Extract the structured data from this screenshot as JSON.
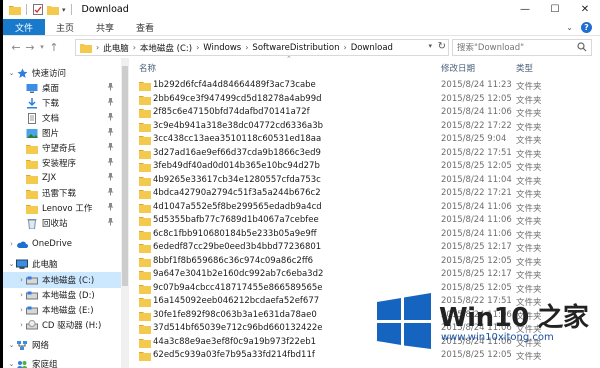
{
  "window": {
    "title": "Download",
    "quick_access_icons": [
      "folder-icon",
      "checkmark-doc-icon",
      "folder-icon"
    ],
    "buttons": [
      "minimize",
      "maximize",
      "close"
    ]
  },
  "ribbon": {
    "tabs": [
      "文件",
      "主页",
      "共享",
      "查看"
    ]
  },
  "address": {
    "crumbs": [
      "此电脑",
      "本地磁盘 (C:)",
      "Windows",
      "SoftwareDistribution",
      "Download"
    ],
    "search_placeholder": "搜索\"Download\""
  },
  "nav": {
    "items": [
      {
        "label": "快速访问",
        "icon": "star-icon",
        "level": 0,
        "pinned": false
      },
      {
        "label": "桌面",
        "icon": "desktop-icon",
        "level": 1,
        "pinned": true
      },
      {
        "label": "下载",
        "icon": "download-icon",
        "level": 1,
        "pinned": true
      },
      {
        "label": "文档",
        "icon": "document-icon",
        "level": 1,
        "pinned": true
      },
      {
        "label": "图片",
        "icon": "pictures-icon",
        "level": 1,
        "pinned": true
      },
      {
        "label": "守望奇兵",
        "icon": "folder-icon",
        "level": 1,
        "pinned": true
      },
      {
        "label": "安装程序",
        "icon": "folder-icon",
        "level": 1,
        "pinned": true
      },
      {
        "label": "ZJX",
        "icon": "folder-icon",
        "level": 1,
        "pinned": true
      },
      {
        "label": "迅雷下载",
        "icon": "folder-icon",
        "level": 1,
        "pinned": true
      },
      {
        "label": "Lenovo 工作",
        "icon": "folder-icon",
        "level": 1,
        "pinned": true
      },
      {
        "label": "回收站",
        "icon": "recycle-bin-icon",
        "level": 1,
        "pinned": true
      },
      {
        "label": "OneDrive",
        "icon": "cloud-icon",
        "level": 0,
        "pinned": false
      },
      {
        "label": "此电脑",
        "icon": "computer-icon",
        "level": 0,
        "pinned": false
      },
      {
        "label": "本地磁盘 (C:)",
        "icon": "drive-icon",
        "level": 1,
        "pinned": false
      },
      {
        "label": "本地磁盘 (D:)",
        "icon": "drive-icon",
        "level": 1,
        "pinned": false
      },
      {
        "label": "本地磁盘 (E:)",
        "icon": "drive-icon",
        "level": 1,
        "pinned": false
      },
      {
        "label": "CD 驱动器 (H:)",
        "icon": "cd-drive-icon",
        "level": 1,
        "pinned": false
      },
      {
        "label": "网络",
        "icon": "network-icon",
        "level": 0,
        "pinned": false
      },
      {
        "label": "家庭组",
        "icon": "homegroup-icon",
        "level": 0,
        "pinned": false
      }
    ],
    "selected": "本地磁盘 (C:)"
  },
  "columns": {
    "name": "名称",
    "date": "修改日期",
    "type": "类型"
  },
  "files": [
    {
      "name": "1b292d6fcf4a4d84664489f3ac73cabe",
      "date": "2015/8/24 11:23",
      "type": "文件夹"
    },
    {
      "name": "2bb649ce3f947499cd5d18278a4ab99d",
      "date": "2015/8/25 12:05",
      "type": "文件夹"
    },
    {
      "name": "2f85c6e47150bfd74dafbd70141a72f",
      "date": "2015/8/24 11:06",
      "type": "文件夹"
    },
    {
      "name": "3c9e4b941a318e38dc04772cd6336a3b",
      "date": "2015/8/22 17:22",
      "type": "文件夹"
    },
    {
      "name": "3cc438cc13aea3510118c60531ed18aa",
      "date": "2015/8/25 9:04",
      "type": "文件夹"
    },
    {
      "name": "3d27ad16ae9ef66d37cda9b1866c3ed9",
      "date": "2015/8/22 17:51",
      "type": "文件夹"
    },
    {
      "name": "3feb49df40ad0d014b365e10bc94d27b",
      "date": "2015/8/25 12:05",
      "type": "文件夹"
    },
    {
      "name": "4b9265e33617cb34e1280557cfda753c",
      "date": "2015/8/24 11:04",
      "type": "文件夹"
    },
    {
      "name": "4bdca42790a2794c51f3a5a244b676c2",
      "date": "2015/8/22 17:21",
      "type": "文件夹"
    },
    {
      "name": "4d1047a552e5f8be299565edadb9a4cd",
      "date": "2015/8/24 11:06",
      "type": "文件夹"
    },
    {
      "name": "5d5355bafb77c7689d1b4067a7cebfee",
      "date": "2015/8/24 11:06",
      "type": "文件夹"
    },
    {
      "name": "6c8c1fbb910680184b5e233b05a9e9ff",
      "date": "2015/8/24 11:06",
      "type": "文件夹"
    },
    {
      "name": "6ededf87cc29be0eed3b4bbd77236801",
      "date": "2015/8/25 12:17",
      "type": "文件夹"
    },
    {
      "name": "8bbf1f8b659686c36c974c09a86c2ff6",
      "date": "2015/8/25 12:05",
      "type": "文件夹"
    },
    {
      "name": "9a647e3041b2e160dc992ab7c6eba3d2",
      "date": "2015/8/25 12:17",
      "type": "文件夹"
    },
    {
      "name": "9c07b9a4cbcc418717455e866589565e",
      "date": "2015/8/25 12:05",
      "type": "文件夹"
    },
    {
      "name": "16a145092eeb046212bcdaefa52ef677",
      "date": "2015/8/22 17:51",
      "type": "文件夹"
    },
    {
      "name": "30fe1fe892f98c063b3a1e631da78ae0",
      "date": "2015/8/24 11:06",
      "type": "文件夹"
    },
    {
      "name": "37d514bf65039e712c96bd660132422e",
      "date": "2015/8/24 11:06",
      "type": "文件夹"
    },
    {
      "name": "44a3c88e9ae3ef8f0c9a19b973f22eb1",
      "date": "2015/8/24 11:06",
      "type": "文件夹"
    },
    {
      "name": "62ed5c939a03fe7b95a33fd214fbd11f",
      "date": "2015/8/25 12:05",
      "type": "文件夹"
    }
  ],
  "watermark": {
    "brand": "Win10 之家",
    "url": "www.win10xitong.com",
    "colors": {
      "logo": "#1565c0",
      "url": "#1b4fa0"
    }
  },
  "colors": {
    "file_tab": "#1979ca",
    "selection": "#cce8ff",
    "folder": "#f3c94e",
    "header_text": "#4c607a"
  }
}
